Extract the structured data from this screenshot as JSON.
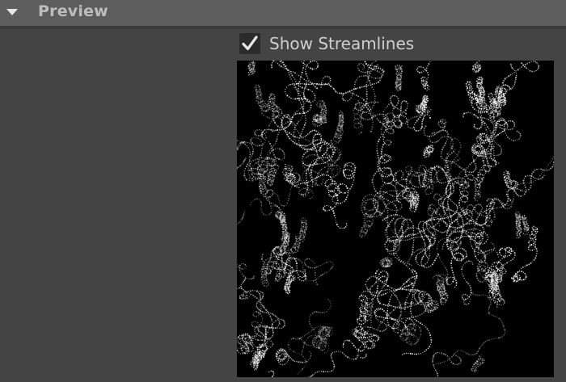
{
  "section": {
    "title": "Preview",
    "expanded": true,
    "arrow_icon": "triangle-down-icon"
  },
  "streamlines_toggle": {
    "label": "Show Streamlines",
    "checked": true,
    "check_icon": "checkmark-icon"
  },
  "preview": {
    "background": "#000000",
    "line_color": "#ffffff"
  }
}
